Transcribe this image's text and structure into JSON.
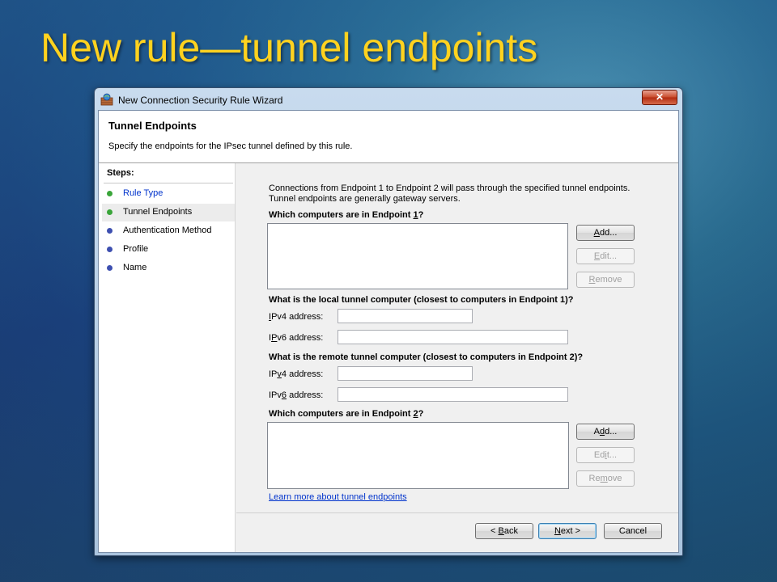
{
  "slide": {
    "title": "New rule—tunnel endpoints"
  },
  "window": {
    "title": "New Connection Security Rule Wizard",
    "close_glyph": "✕"
  },
  "header": {
    "title": "Tunnel Endpoints",
    "description": "Specify the endpoints for the IPsec tunnel defined by this rule."
  },
  "steps": {
    "title": "Steps:",
    "items": [
      {
        "label": "Rule Type",
        "state": "completed"
      },
      {
        "label": "Tunnel Endpoints",
        "state": "current"
      },
      {
        "label": "Authentication Method",
        "state": "pending"
      },
      {
        "label": "Profile",
        "state": "pending"
      },
      {
        "label": "Name",
        "state": "pending"
      }
    ]
  },
  "main": {
    "intro_line1": "Connections from Endpoint 1 to Endpoint 2 will pass through the specified tunnel endpoints.",
    "intro_line2": "Tunnel endpoints are generally gateway servers.",
    "endpoint1": {
      "label_pre": "Which computers are in Endpoint ",
      "label_key": "1",
      "label_post": "?",
      "add": {
        "pre": "",
        "key": "A",
        "post": "dd..."
      },
      "edit": {
        "pre": "",
        "key": "E",
        "post": "dit..."
      },
      "remove": {
        "pre": "",
        "key": "R",
        "post": "emove"
      }
    },
    "local_tunnel": {
      "label": "What is the local tunnel computer (closest to computers in Endpoint 1)?",
      "ipv4": {
        "pre": "",
        "key": "I",
        "post": "Pv4 address:",
        "value": ""
      },
      "ipv6": {
        "pre": "I",
        "key": "P",
        "post": "v6 address:",
        "value": ""
      }
    },
    "remote_tunnel": {
      "label": "What is the remote tunnel computer (closest to computers in Endpoint 2)?",
      "ipv4": {
        "pre": "IP",
        "key": "v",
        "post": "4 address:",
        "value": ""
      },
      "ipv6": {
        "pre": "IPv",
        "key": "6",
        "post": " address:",
        "value": ""
      }
    },
    "endpoint2": {
      "label_pre": "Which computers are in Endpoint ",
      "label_key": "2",
      "label_post": "?",
      "add": {
        "pre": "A",
        "key": "d",
        "post": "d..."
      },
      "edit": {
        "pre": "Ed",
        "key": "i",
        "post": "t..."
      },
      "remove": {
        "pre": "Re",
        "key": "m",
        "post": "ove"
      }
    },
    "learn_more": "Learn more about tunnel endpoints"
  },
  "footer": {
    "back": {
      "pre": "< ",
      "key": "B",
      "post": "ack"
    },
    "next": {
      "pre": "",
      "key": "N",
      "post": "ext >"
    },
    "cancel": "Cancel"
  },
  "colors": {
    "title": "#ffd21f",
    "step_completed": "#3aa53a",
    "step_current": "#3aa53a",
    "step_pending": "#3d4fb0",
    "link": "#0033cc"
  }
}
